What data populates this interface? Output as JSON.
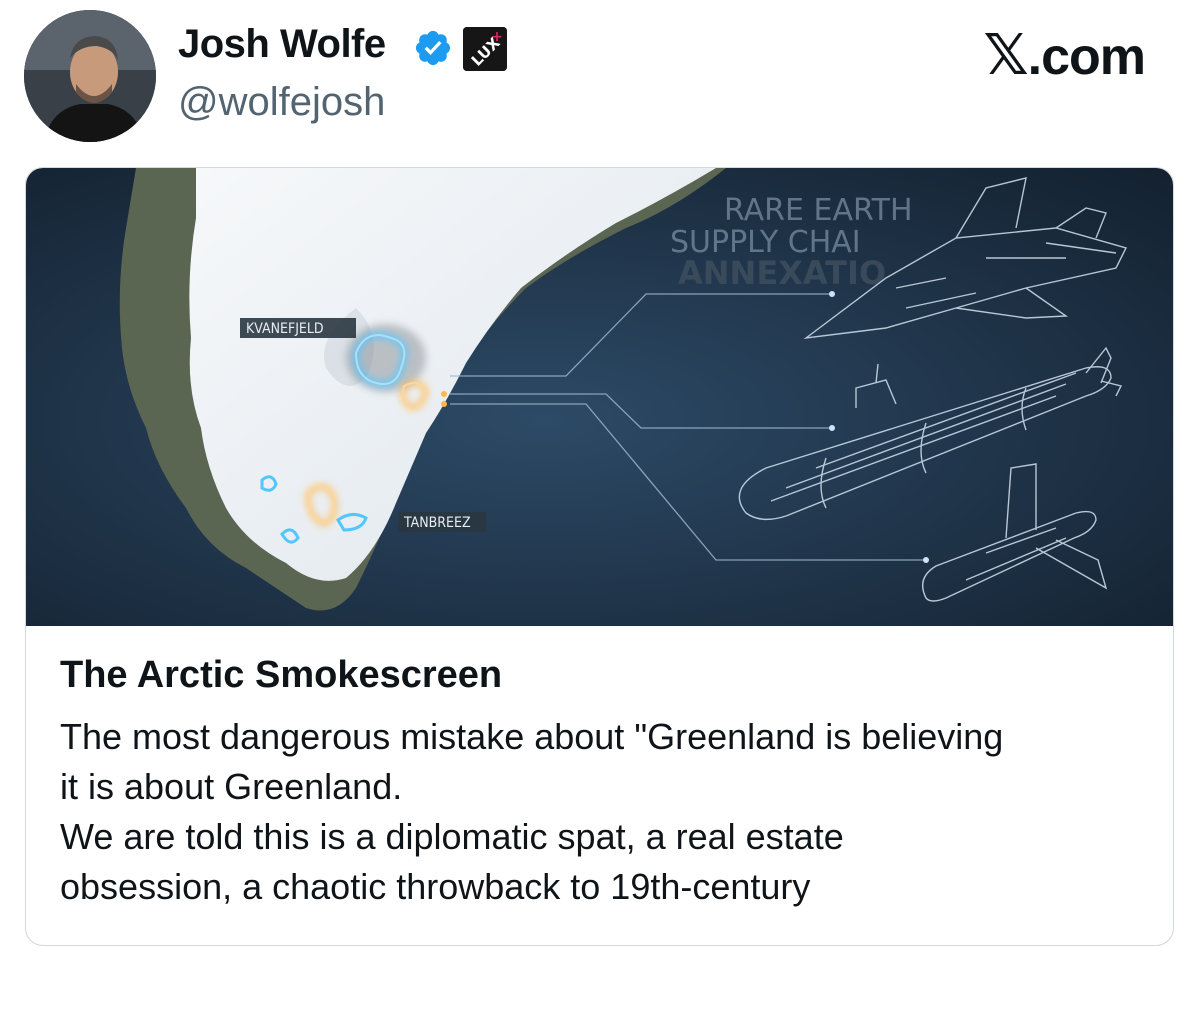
{
  "author": {
    "name": "Josh Wolfe",
    "handle": "@wolfejosh",
    "verified_color": "#1d9bf0",
    "affiliation_badge": "Lux",
    "avatar_icon": "avatar-photo"
  },
  "brand": {
    "logo_glyph": "𝕏",
    "suffix": ".com"
  },
  "card": {
    "image": {
      "caption_lines": [
        "RARE EARTH",
        "SUPPLY CHAI",
        "ANNEXATIO"
      ],
      "labels": {
        "kvanefjeld": "KVANEFJELD",
        "tanbreez": "TANBREEZ"
      }
    },
    "title": "The Arctic Smokescreen",
    "description_lines": [
      "The most dangerous mistake about \"Greenland  is believing",
      "it is about Greenland.",
      "We are told this is a diplomatic spat, a real estate",
      "obsession, a chaotic throwback to 19th-century"
    ]
  }
}
